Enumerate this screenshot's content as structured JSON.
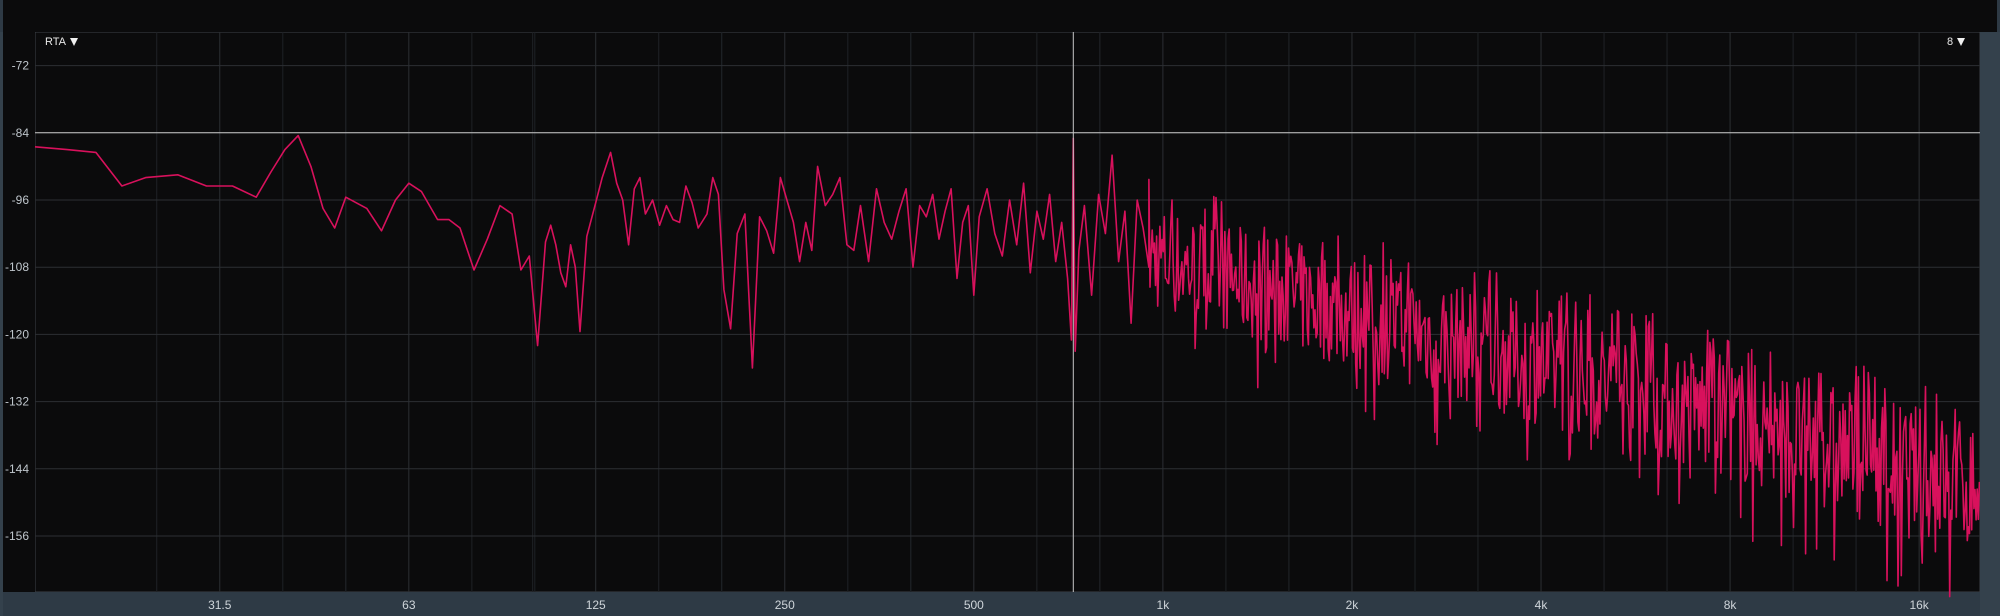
{
  "toolbar": {
    "left_menu_label": "RTA",
    "right_menu_label": "8"
  },
  "colors": {
    "background": "#0b0b0c",
    "grid": "#2c2f33",
    "trace": "#d8115c",
    "marker": "#c9c9c9"
  },
  "cursor": {
    "level_db": -84,
    "frequency_hz": 720
  },
  "chart_data": {
    "type": "line",
    "xscale": "log",
    "xlim": [
      16,
      20000
    ],
    "ylim": [
      -166,
      -66
    ],
    "grid": true,
    "x_ticks": [
      {
        "value": 31.5,
        "label": "31.5"
      },
      {
        "value": 63,
        "label": "63"
      },
      {
        "value": 125,
        "label": "125"
      },
      {
        "value": 250,
        "label": "250"
      },
      {
        "value": 500,
        "label": "500"
      },
      {
        "value": 1000,
        "label": "1k"
      },
      {
        "value": 2000,
        "label": "2k"
      },
      {
        "value": 4000,
        "label": "4k"
      },
      {
        "value": 8000,
        "label": "8k"
      },
      {
        "value": 16000,
        "label": "16k"
      }
    ],
    "y_ticks": [
      {
        "value": -72,
        "label": "-72"
      },
      {
        "value": -84,
        "label": "-84"
      },
      {
        "value": -96,
        "label": "-96"
      },
      {
        "value": -108,
        "label": "-108"
      },
      {
        "value": -120,
        "label": "-120"
      },
      {
        "value": -132,
        "label": "-132"
      },
      {
        "value": -144,
        "label": "-144"
      },
      {
        "value": -156,
        "label": "-156"
      }
    ],
    "series": [
      {
        "x": [
          16,
          18,
          20,
          22,
          24,
          27,
          30,
          33,
          36,
          38,
          40,
          42,
          44,
          46,
          48,
          50,
          54,
          57,
          60,
          63,
          66,
          70,
          73,
          76,
          80,
          84,
          88,
          92,
          95,
          98,
          101,
          104,
          106,
          108,
          110,
          112,
          114,
          116,
          118,
          121,
          125,
          128,
          132,
          135,
          138,
          141,
          144,
          147,
          150,
          154,
          158,
          162,
          166,
          170,
          174,
          178,
          182,
          188,
          192,
          196,
          200,
          205,
          210,
          216,
          222,
          228,
          234,
          240,
          246,
          252,
          258,
          264,
          270,
          276,
          282,
          290,
          298,
          306,
          314,
          322,
          330,
          340,
          350,
          360,
          370,
          380,
          390,
          400,
          410,
          420,
          430,
          440,
          450,
          460,
          470,
          480,
          490,
          500,
          510,
          525,
          540,
          555,
          570,
          585,
          600,
          615,
          630,
          645,
          660,
          675,
          690,
          705,
          715,
          720,
          725,
          735,
          750,
          770,
          790,
          810,
          830,
          850,
          870,
          890,
          910,
          930,
          950
        ],
        "y": [
          -86.5,
          -87,
          -87.5,
          -93.5,
          -92,
          -91.5,
          -93.5,
          -93.5,
          -95.5,
          -91,
          -87,
          -84.5,
          -90,
          -97.5,
          -101,
          -95.5,
          -97.5,
          -101.5,
          -96,
          -93,
          -94.5,
          -99.5,
          -99.5,
          -101,
          -108.5,
          -103,
          -97,
          -98.5,
          -108.5,
          -106,
          -122,
          -103.5,
          -100.5,
          -104,
          -109,
          -111.5,
          -104,
          -108,
          -119.5,
          -102.5,
          -96.5,
          -92,
          -87.5,
          -93,
          -96,
          -104,
          -94,
          -92,
          -98.5,
          -96,
          -100.5,
          -97,
          -99.5,
          -100,
          -93.5,
          -96.5,
          -101,
          -98.5,
          -92,
          -95,
          -112,
          -119,
          -102,
          -98.5,
          -126,
          -99,
          -101.5,
          -105.5,
          -92,
          -96,
          -100,
          -107,
          -100,
          -105,
          -90,
          -97,
          -95,
          -92,
          -104,
          -105,
          -97,
          -107,
          -94,
          -100,
          -103,
          -98,
          -94,
          -108,
          -97,
          -99,
          -95,
          -103,
          -98,
          -94,
          -110,
          -100,
          -97,
          -113,
          -99,
          -94,
          -102,
          -106,
          -96,
          -104,
          -93,
          -109,
          -98,
          -103,
          -95,
          -107,
          -100,
          -110,
          -121,
          -85,
          -123,
          -105,
          -97,
          -113,
          -95,
          -102,
          -88,
          -107,
          -98,
          -118,
          -96,
          -101,
          -108
        ]
      }
    ],
    "noise_region": {
      "x_range": [
        950,
        20000
      ],
      "upper_db": [
        -96,
        -135
      ],
      "lower_db": [
        -116,
        -160
      ]
    }
  }
}
